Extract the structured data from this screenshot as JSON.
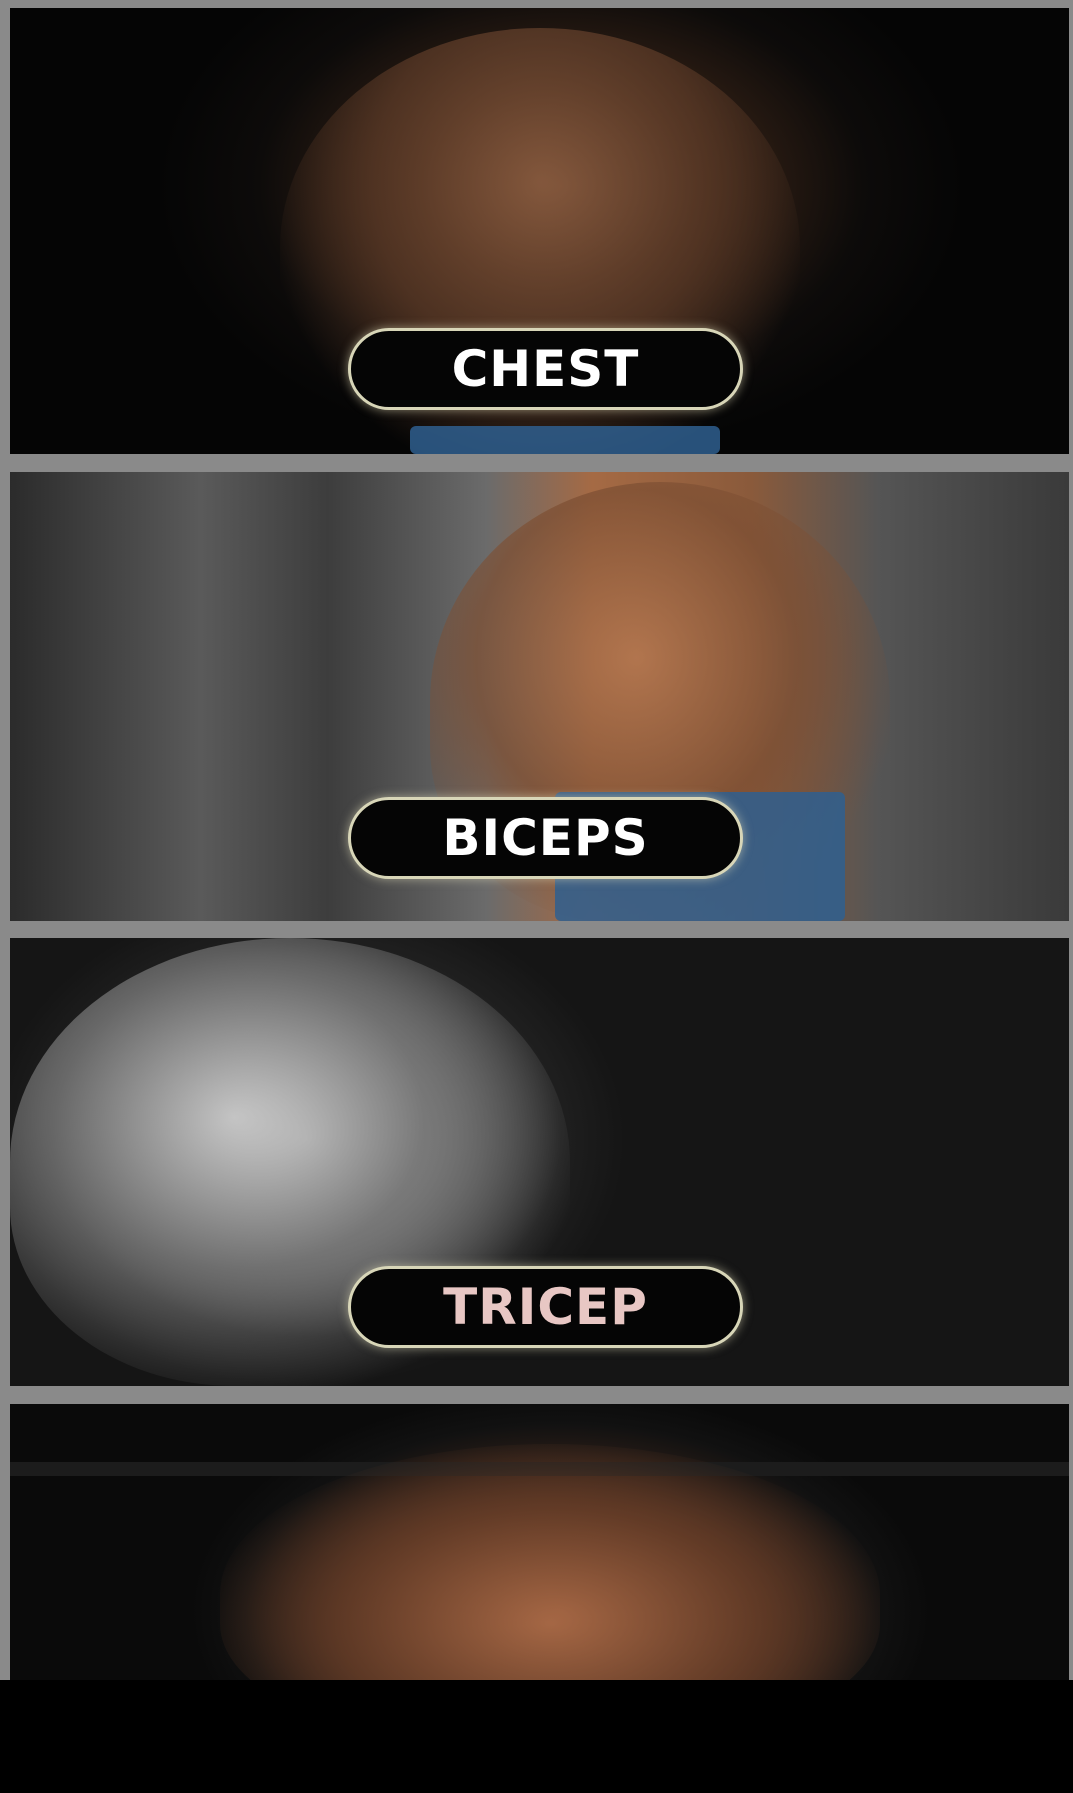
{
  "workout_categories": [
    {
      "id": "chest",
      "label": "CHEST",
      "label_color": "#ffffff"
    },
    {
      "id": "biceps",
      "label": "BICEPS",
      "label_color": "#ffffff"
    },
    {
      "id": "tricep",
      "label": "TRICEP",
      "label_color": "#e8c7c4"
    },
    {
      "id": "back",
      "label": ""
    }
  ],
  "colors": {
    "pill_background": "#050505",
    "pill_border": "#d8d6b8",
    "frame": "#8a8a8a",
    "bottom_bar": "#000000"
  }
}
